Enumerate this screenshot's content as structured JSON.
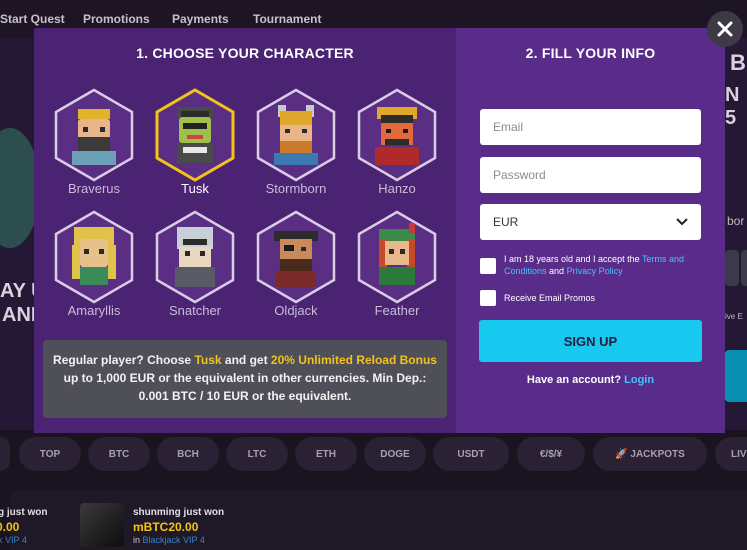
{
  "nav": {
    "items": [
      "Start Quest",
      "Promotions",
      "Payments",
      "Tournament"
    ]
  },
  "hero": {
    "fragments": [
      "B",
      "N 5",
      "AY U",
      "ANI",
      "bor",
      "ive E"
    ]
  },
  "categories": [
    "TOP",
    "BTC",
    "BCH",
    "LTC",
    "ETH",
    "DOGE",
    "USDT",
    "€/$/¥",
    "🚀 JACKPOTS",
    "LIV"
  ],
  "recent_wins": [
    {
      "title": "g just won",
      "amount": "0.00",
      "sub": "k VIP 4"
    },
    {
      "title": "shunming just won",
      "amount": "mBTC20.00",
      "sub_prefix": "in",
      "sub_link": "Blackjack VIP 4"
    }
  ],
  "modal": {
    "step1_title": "1. CHOOSE YOUR CHARACTER",
    "step2_title": "2. FILL YOUR INFO",
    "characters": [
      {
        "name": "Braverus",
        "selected": false
      },
      {
        "name": "Tusk",
        "selected": true
      },
      {
        "name": "Stormborn",
        "selected": false
      },
      {
        "name": "Hanzo",
        "selected": false
      },
      {
        "name": "Amaryllis",
        "selected": false
      },
      {
        "name": "Snatcher",
        "selected": false
      },
      {
        "name": "Oldjack",
        "selected": false
      },
      {
        "name": "Feather",
        "selected": false
      }
    ],
    "promo": {
      "text1": "Regular player? Choose",
      "char": "Tusk",
      "text2": "and get",
      "bonus": "20% Unlimited Reload Bonus",
      "text3": "up to 1,000 EUR or the equivalent in other currencies. Min Dep.: 0.001 BTC / 10 EUR or the equivalent."
    },
    "form": {
      "email_placeholder": "Email",
      "password_placeholder": "Password",
      "currency": "EUR",
      "terms_prefix": "I am 18 years old and I accept the",
      "terms_link": "Terms and Conditions",
      "terms_and": "and",
      "privacy_link": "Privacy Policy",
      "promos_label": "Receive Email Promos",
      "signup_label": "SIGN UP",
      "account_text": "Have an account?",
      "login_link": "Login"
    }
  },
  "colors": {
    "accent_cyan": "#17c8ef",
    "highlight_yellow": "#f3c318",
    "link_blue": "#45c3ff",
    "left_pane": "#4a2372",
    "right_pane": "#5a2c8a"
  },
  "icons": {
    "close": "close-icon",
    "dropdown": "chevron-down-icon"
  }
}
